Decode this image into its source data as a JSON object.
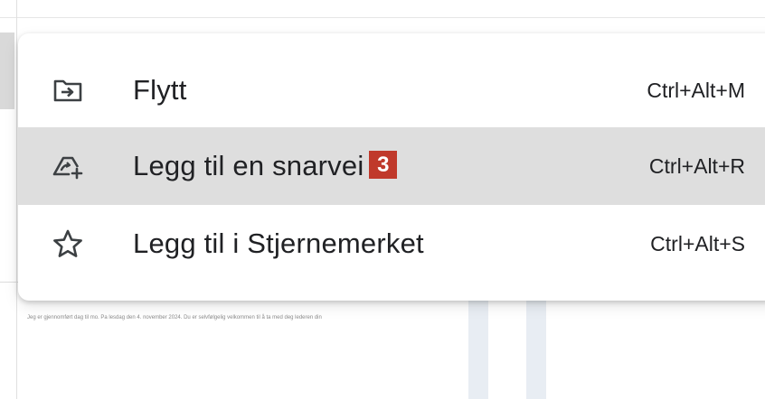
{
  "background": {
    "fine_print": "Jeg er gjennomført dag til mo. Pa lesdag den 4. november 2024. Du er selvfølgelig velkommen til å ta med deg lederen din"
  },
  "menu": {
    "items": [
      {
        "label": "Flytt",
        "shortcut": "Ctrl+Alt+M",
        "icon": "move-to-folder-icon"
      },
      {
        "label": "Legg til en snarvei",
        "shortcut": "Ctrl+Alt+R",
        "icon": "add-shortcut-icon",
        "badge": "3",
        "highlighted": true
      },
      {
        "label": "Legg til i Stjernemerket",
        "shortcut": "Ctrl+Alt+S",
        "icon": "star-outline-icon"
      }
    ]
  },
  "colors": {
    "highlight": "#dedede",
    "badge": "#c0392b",
    "icon": "#3c4043"
  }
}
